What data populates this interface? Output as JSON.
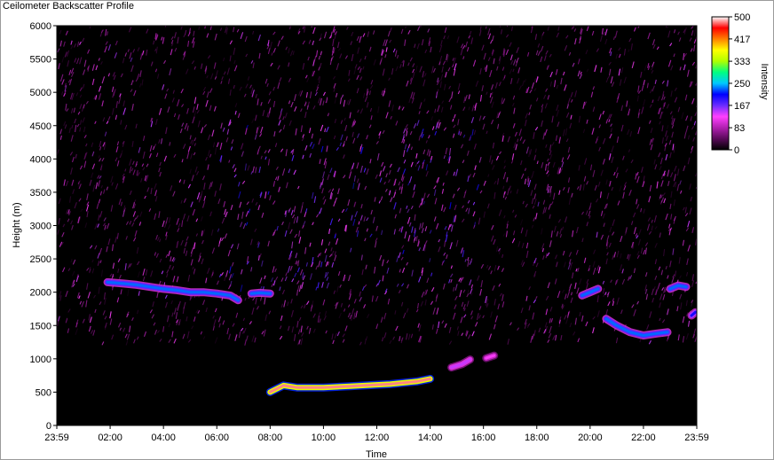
{
  "window": {
    "title": "Ceilometer Backscatter Profile"
  },
  "chart_data": {
    "type": "heatmap",
    "title": "",
    "xlabel": "Time",
    "ylabel": "Height (m)",
    "colorbar_label": "Intensity",
    "x_ticks": [
      "23:59",
      "02:00",
      "04:00",
      "06:00",
      "08:00",
      "10:00",
      "12:00",
      "14:00",
      "16:00",
      "18:00",
      "20:00",
      "22:00",
      "23:59"
    ],
    "x_tick_hours": [
      0,
      2,
      4,
      6,
      8,
      10,
      12,
      14,
      16,
      18,
      20,
      22,
      24
    ],
    "xlim_hours": [
      0,
      24
    ],
    "y_ticks": [
      "6000",
      "5500",
      "5000",
      "4500",
      "4000",
      "3500",
      "3000",
      "2500",
      "2000",
      "1500",
      "1000",
      "500",
      "0"
    ],
    "ylim": [
      0,
      6000
    ],
    "colorbar_ticks": [
      "500",
      "417",
      "333",
      "250",
      "167",
      "83",
      "0"
    ],
    "colorbar_range": [
      0,
      500
    ],
    "colormap": [
      "#000000",
      "#5a0a5a",
      "#b020b0",
      "#ff40ff",
      "#6a2cff",
      "#0000ff",
      "#00c8ff",
      "#00ff80",
      "#b0ff00",
      "#ffff00",
      "#ff8000",
      "#ff0000",
      "#ffffff"
    ],
    "background_noise": {
      "height_range": [
        1200,
        6000
      ],
      "intensity_range": [
        20,
        140
      ],
      "core_hours": [
        6,
        16
      ],
      "core_height": [
        2000,
        4500
      ]
    },
    "layers": [
      {
        "name_hint": "",
        "points": [
          [
            1.9,
            2150
          ],
          [
            2.5,
            2130
          ],
          [
            3.0,
            2110
          ],
          [
            3.5,
            2080
          ],
          [
            4.0,
            2050
          ],
          [
            4.5,
            2030
          ],
          [
            5.0,
            2000
          ],
          [
            5.5,
            2000
          ],
          [
            6.0,
            1980
          ],
          [
            6.5,
            1950
          ],
          [
            6.8,
            1880
          ]
        ],
        "intensity": 230
      },
      {
        "points": [
          [
            7.3,
            1980
          ],
          [
            7.6,
            1990
          ],
          [
            8.0,
            1980
          ]
        ],
        "intensity": 230
      },
      {
        "points": [
          [
            8.0,
            500
          ],
          [
            8.5,
            600
          ],
          [
            9.0,
            570
          ],
          [
            10.0,
            570
          ],
          [
            11.0,
            590
          ],
          [
            12.0,
            610
          ],
          [
            12.5,
            620
          ],
          [
            13.0,
            640
          ],
          [
            13.5,
            660
          ],
          [
            14.0,
            700
          ]
        ],
        "intensity": 480
      },
      {
        "points": [
          [
            14.8,
            870
          ],
          [
            15.2,
            920
          ],
          [
            15.5,
            990
          ]
        ],
        "intensity": 140
      },
      {
        "points": [
          [
            16.1,
            1010
          ],
          [
            16.4,
            1050
          ]
        ],
        "intensity": 120
      },
      {
        "points": [
          [
            19.7,
            1950
          ],
          [
            20.0,
            2000
          ],
          [
            20.3,
            2050
          ]
        ],
        "intensity": 230
      },
      {
        "points": [
          [
            20.6,
            1600
          ],
          [
            21.0,
            1500
          ],
          [
            21.5,
            1400
          ],
          [
            22.0,
            1350
          ],
          [
            22.5,
            1380
          ],
          [
            22.9,
            1400
          ]
        ],
        "intensity": 230
      },
      {
        "points": [
          [
            23.0,
            2050
          ],
          [
            23.3,
            2100
          ],
          [
            23.6,
            2080
          ]
        ],
        "intensity": 230
      },
      {
        "points": [
          [
            23.8,
            1650
          ],
          [
            23.95,
            1700
          ]
        ],
        "intensity": 200
      }
    ]
  }
}
